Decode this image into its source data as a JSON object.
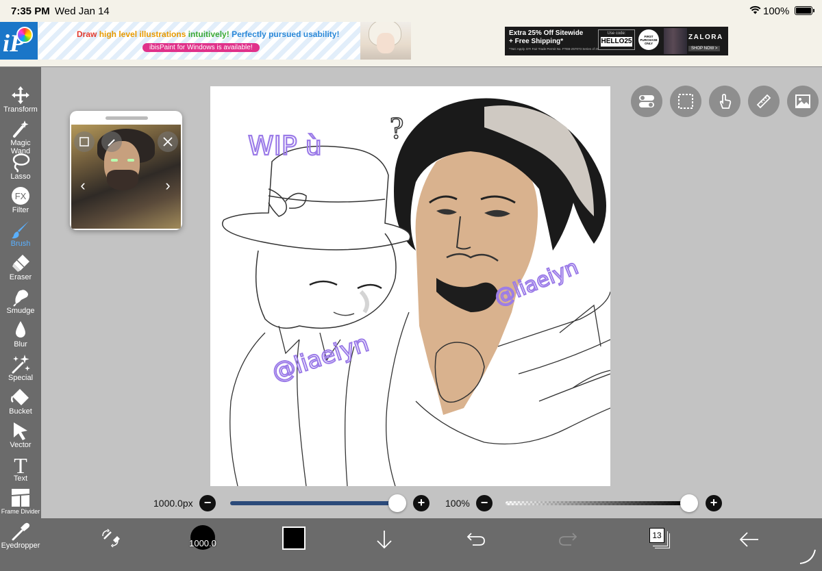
{
  "status": {
    "time": "7:35 PM",
    "date": "Wed Jan 14",
    "battery": "100%"
  },
  "ads": {
    "ibis": {
      "headline_parts": [
        "Draw ",
        "high level illustrations ",
        "intuitively! ",
        "Perfectly pursued usability!"
      ],
      "headline_colors": [
        "#e23a2e",
        "#e89a00",
        "#3aa935",
        "#2a88d8"
      ],
      "pill": "ibisPaint for Windows is available!"
    },
    "zalora": {
      "line1": "Extra 25% Off Sitewide",
      "line2": "+ Free Shipping*",
      "fine": "*T&C Apply. DTI Fair Trade Permit No. FTEB-257073 Series of 2025",
      "code_label": "Use code:",
      "code": "HELLO25",
      "badge": "FIRST PURCHASE ONLY",
      "brand": "ZALORA",
      "cta": "SHOP NOW >"
    }
  },
  "tools": [
    {
      "name": "transform",
      "label": "Transform",
      "icon": "move-arrows-icon"
    },
    {
      "name": "magic-wand",
      "label": "Magic Wand",
      "icon": "magic-wand-icon"
    },
    {
      "name": "lasso",
      "label": "Lasso",
      "icon": "lasso-icon"
    },
    {
      "name": "filter",
      "label": "Filter",
      "icon": "fx-icon"
    },
    {
      "name": "brush",
      "label": "Brush",
      "icon": "brush-icon",
      "active": true
    },
    {
      "name": "eraser",
      "label": "Eraser",
      "icon": "eraser-icon"
    },
    {
      "name": "smudge",
      "label": "Smudge",
      "icon": "smudge-icon"
    },
    {
      "name": "blur",
      "label": "Blur",
      "icon": "drop-icon"
    },
    {
      "name": "special",
      "label": "Special",
      "icon": "sparkle-icon"
    },
    {
      "name": "bucket",
      "label": "Bucket",
      "icon": "bucket-icon"
    },
    {
      "name": "vector",
      "label": "Vector",
      "icon": "cursor-arrow-icon"
    },
    {
      "name": "text",
      "label": "Text",
      "icon": "text-t-icon"
    },
    {
      "name": "frame-divider",
      "label": "Frame Divider",
      "icon": "frame-divider-icon"
    },
    {
      "name": "eyedropper",
      "label": "Eyedropper",
      "icon": "eyedropper-icon"
    }
  ],
  "canvas": {
    "wip_text": "WIP ù",
    "watermark1": "@liaeiyn",
    "watermark2": "@liaeiyn",
    "skin_color": "#d9b28e",
    "hair_color": "#1a1a1a",
    "streak_color": "#cfc9c2",
    "watermark_color": "#9b7be8"
  },
  "sliders": {
    "brush_size": "1000.0px",
    "brush_size_fraction": 1.0,
    "opacity": "100%",
    "opacity_fraction": 1.0
  },
  "bottombar": {
    "brush_size_label": "1000.0",
    "color": "#000000",
    "layer_count": "13"
  },
  "accent": "#5ab0ff"
}
